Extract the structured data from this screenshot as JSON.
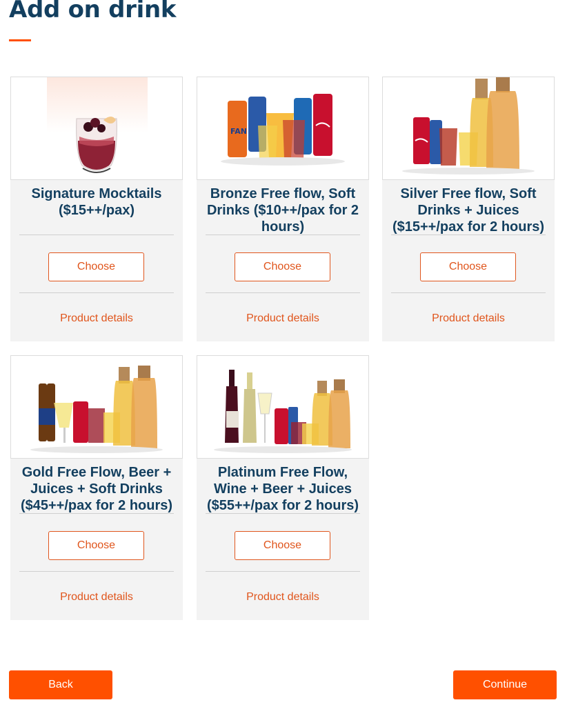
{
  "header": {
    "title": "Add on drink"
  },
  "colors": {
    "accent": "#ff5000",
    "heading": "#133f5f",
    "card_bg": "#f3f3f3"
  },
  "products": [
    {
      "name": "Signature Mocktails ($15++/pax)",
      "choose_label": "Choose",
      "details_label": "Product details",
      "image_icon": "mocktail-glass-image"
    },
    {
      "name": "Bronze Free flow, Soft Drinks ($10++/pax for 2 hours)",
      "choose_label": "Choose",
      "details_label": "Product details",
      "image_icon": "soft-drink-cans-image"
    },
    {
      "name": "Silver Free flow, Soft Drinks + Juices ($15++/pax for 2 hours)",
      "choose_label": "Choose",
      "details_label": "Product details",
      "image_icon": "cans-and-juice-carafes-image"
    },
    {
      "name": "Gold Free Flow, Beer + Juices + Soft Drinks ($45++/pax for 2 hours)",
      "choose_label": "Choose",
      "details_label": "Product details",
      "image_icon": "beer-cans-juices-image"
    },
    {
      "name": "Platinum Free Flow, Wine + Beer + Juices ($55++/pax for 2 hours)",
      "choose_label": "Choose",
      "details_label": "Product details",
      "image_icon": "wine-beer-juices-image"
    }
  ],
  "footer": {
    "back_label": "Back",
    "continue_label": "Continue"
  }
}
